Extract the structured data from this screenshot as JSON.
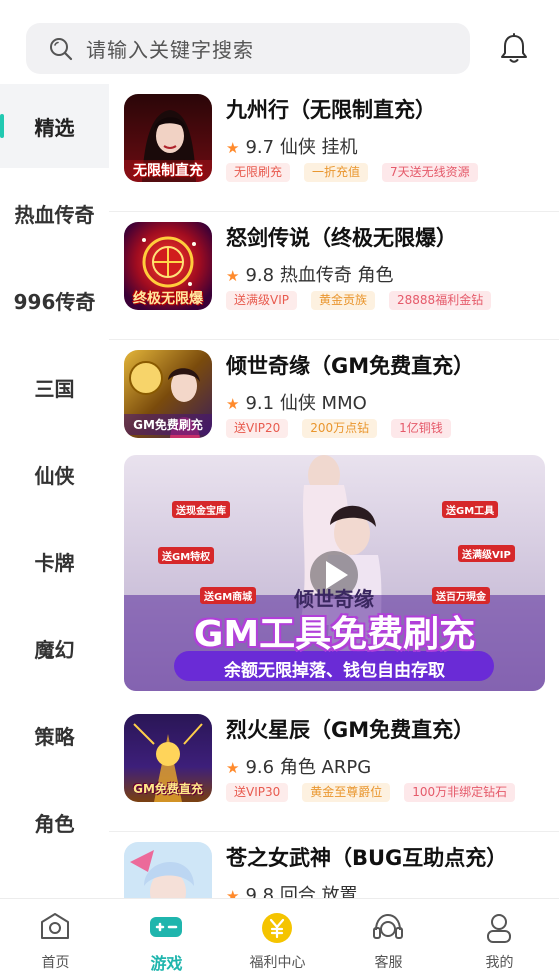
{
  "search": {
    "placeholder": "请输入关键字搜索"
  },
  "sidebar": {
    "items": [
      {
        "label": "精选",
        "active": true
      },
      {
        "label": "热血传奇"
      },
      {
        "label": "996传奇"
      },
      {
        "label": "三国"
      },
      {
        "label": "仙侠"
      },
      {
        "label": "卡牌"
      },
      {
        "label": "魔幻"
      },
      {
        "label": "策略"
      },
      {
        "label": "角色"
      }
    ]
  },
  "games": [
    {
      "title": "九州行（无限制直充）",
      "rating": "9.7",
      "genres": "仙侠 挂机",
      "tags": [
        "无限刷充",
        "一折充值",
        "7天送无线资源"
      ],
      "thumb_text": "无限制直充"
    },
    {
      "title": "怒剑传说（终极无限爆）",
      "rating": "9.8",
      "genres": "热血传奇 角色",
      "tags": [
        "送满级VIP",
        "黄金贡族",
        "28888福利金钻"
      ],
      "thumb_text": "终极无限爆"
    },
    {
      "title": "倾世奇缘（GM免费直充）",
      "rating": "9.1",
      "genres": "仙侠 MMO",
      "tags": [
        "送VIP20",
        "200万点钻",
        "1亿铜钱"
      ],
      "thumb_text": "GM免费刷充"
    },
    {
      "title": "烈火星辰（GM免费直充）",
      "rating": "9.6",
      "genres": "角色 ARPG",
      "tags": [
        "送VIP30",
        "黄金至尊爵位",
        "100万非绑定钻石"
      ],
      "thumb_text": "GM免费直充"
    },
    {
      "title": "苍之女武神（BUG互助点充）",
      "rating": "9.8",
      "genres": "回合 放置",
      "tags": []
    }
  ],
  "banner": {
    "logo_text": "倾世奇缘",
    "headline": "GM工具免费刷充",
    "subline": "余额无限掉落、钱包自由存取",
    "badges": [
      "送现金宝库",
      "送GM工具",
      "送GM特权",
      "送满级VIP",
      "送GM商城",
      "送百万現金"
    ]
  },
  "tabbar": {
    "items": [
      {
        "label": "首页"
      },
      {
        "label": "游戏",
        "active": true
      },
      {
        "label": "福利中心"
      },
      {
        "label": "客服"
      },
      {
        "label": "我的"
      }
    ]
  },
  "colors": {
    "accent": "#1fb5ad",
    "star": "#ff8a2c",
    "coin": "#f5c400"
  }
}
